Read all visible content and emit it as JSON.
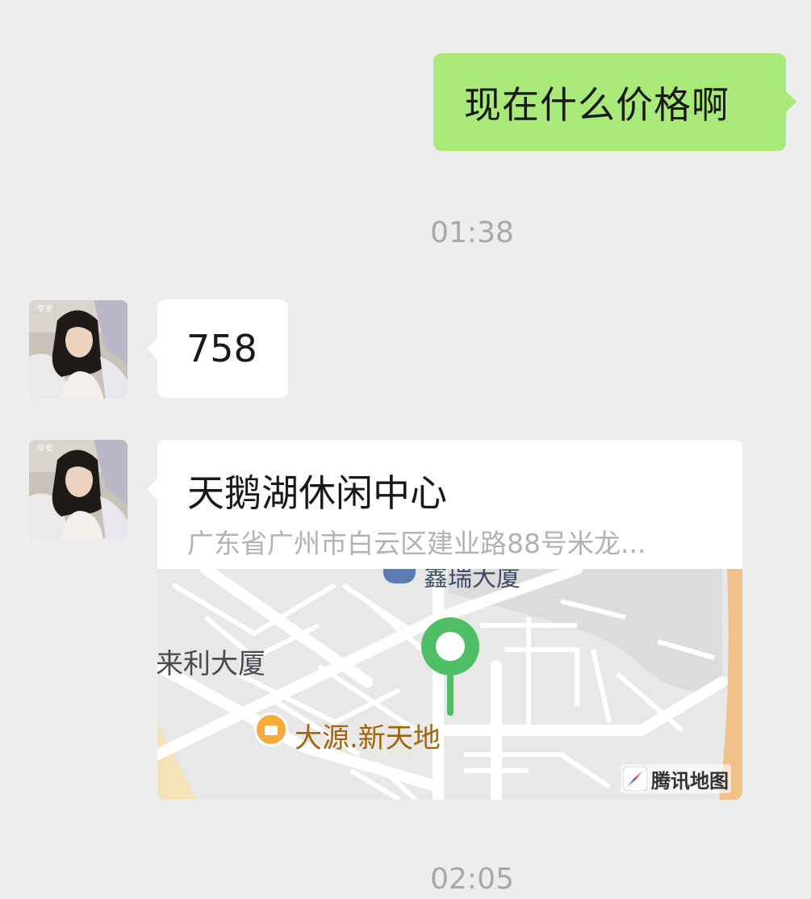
{
  "messages": {
    "outgoing_1": {
      "text": "现在什么价格啊"
    },
    "timestamp_1": "01:38",
    "incoming_1": {
      "text": "758"
    },
    "incoming_location": {
      "title": "天鹅湖休闲中心",
      "address": "广东省广州市白云区建业路88号米龙...",
      "map": {
        "label_top": "鑫瑞大厦",
        "label_building": "来利大厦",
        "label_poi": "大源.新天地",
        "watermark": "腾讯地图"
      }
    },
    "timestamp_2": "02:05"
  },
  "avatar": {
    "badge_text": "早安"
  },
  "colors": {
    "background": "#ededed",
    "outgoing_bubble": "#a9e97a",
    "incoming_bubble": "#ffffff",
    "timestamp_text": "#a8a8a8",
    "pin": "#4fbf67",
    "poi": "#f6ac3a"
  }
}
